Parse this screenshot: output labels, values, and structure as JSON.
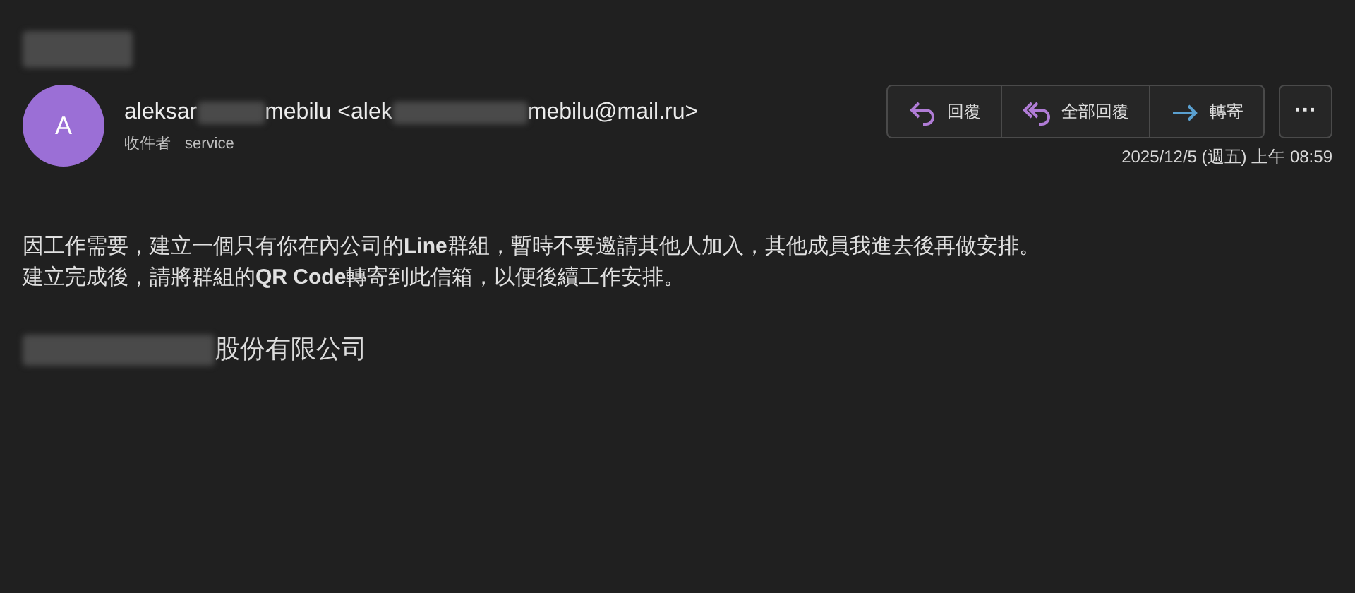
{
  "subject": {
    "kind": "redacted"
  },
  "sender": {
    "avatar": "A",
    "parts": [
      {
        "kind": "text",
        "text": "aleksar"
      },
      {
        "kind": "redacted"
      },
      {
        "kind": "text",
        "text": "mebilu <alek"
      },
      {
        "kind": "redacted"
      },
      {
        "kind": "text",
        "text": "mebilu@mail.ru>"
      }
    ],
    "to_label": "收件者",
    "to": "service"
  },
  "actions": [
    {
      "kind": "reply",
      "label": "回覆"
    },
    {
      "kind": "reply_all",
      "label": "全部回覆"
    },
    {
      "kind": "forward",
      "label": "轉寄"
    }
  ],
  "more": "···",
  "date": "2025/12/5 (週五) 上午 08:59",
  "body": [
    "因工作需要，建立一個只有你在內公司的**Line**群組，暫時不要邀請其他人加入，其他成員我進去後再做安排。",
    "建立完成後，請將群組的**QR Code**轉寄到此信箱，以便後續工作安排。"
  ],
  "signature": {
    "parts": [
      {
        "kind": "redacted"
      },
      {
        "kind": "text",
        "text": "股份有限公司"
      }
    ]
  }
}
